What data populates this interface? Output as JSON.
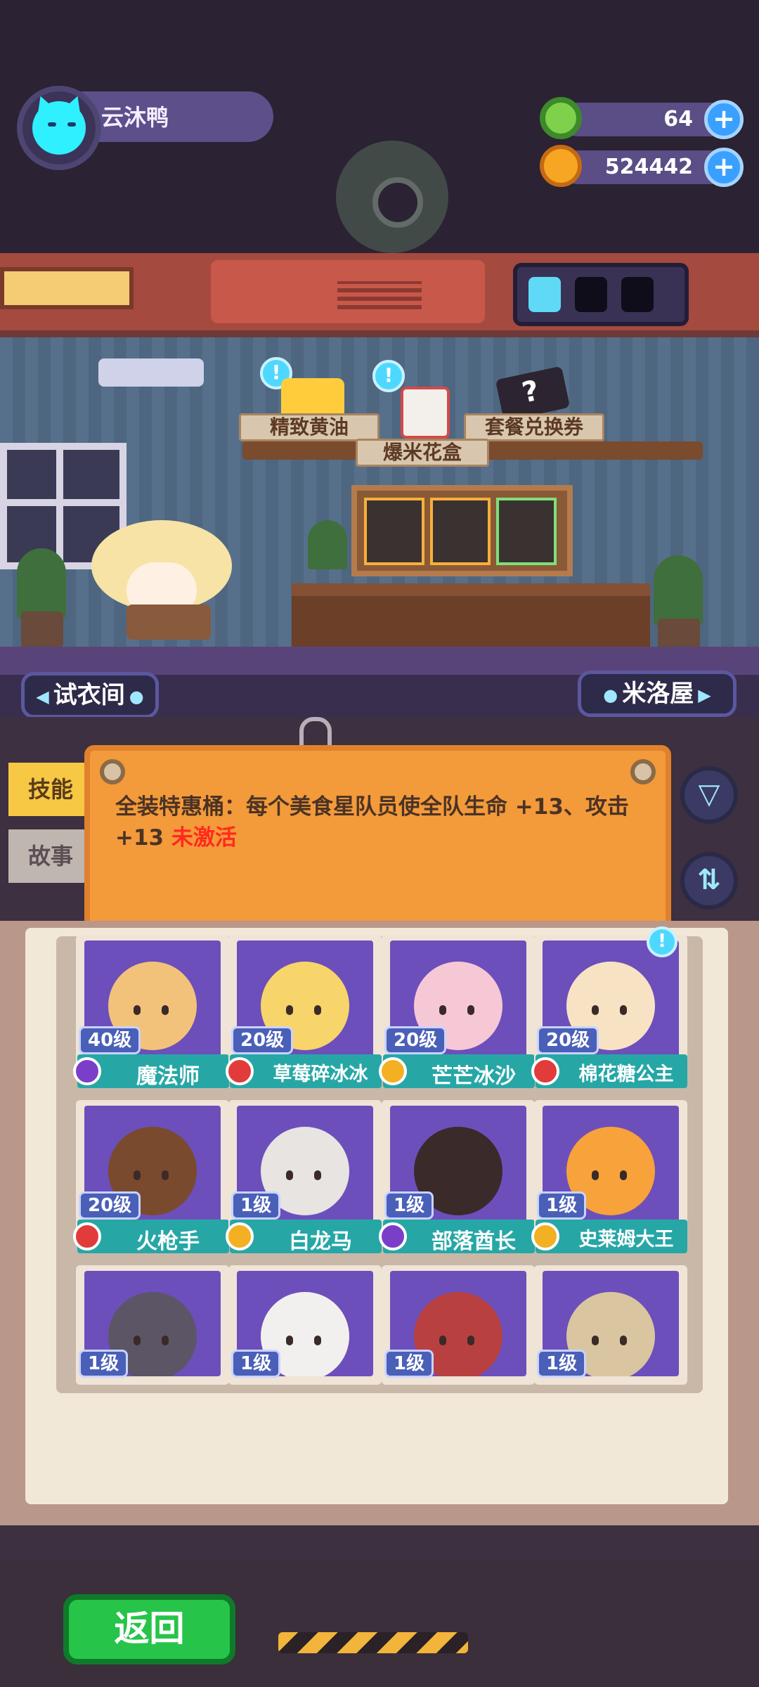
{
  "player": {
    "name": "云沐鸭"
  },
  "currencies": [
    {
      "name": "donut",
      "value": "64",
      "color": "#7fd04b"
    },
    {
      "name": "planet-coin",
      "value": "524442",
      "color": "#f6a623"
    }
  ],
  "shop_items": [
    {
      "label": "精致黄油"
    },
    {
      "label": "爆米花盒"
    },
    {
      "label": "套餐兑换券"
    }
  ],
  "scene_nav": {
    "left": "试衣间",
    "right": "米洛屋"
  },
  "side_tabs": [
    "技能",
    "故事"
  ],
  "skill": {
    "text": "全装特惠桶：每个美食星队员使全队生命 +13、攻击 +13",
    "status": "未激活"
  },
  "icons": {
    "filter": "filter-icon",
    "sort": "sort-icon",
    "plus": "plus-icon",
    "notice": "exclamation-icon"
  },
  "characters": [
    {
      "level": "40级",
      "name": "魔法师",
      "badge_color": "#7a3fc9",
      "head_color": "#f3c27a"
    },
    {
      "level": "20级",
      "name": "草莓碎冰冰",
      "badge_color": "#e23b3b",
      "head_color": "#f7d56a"
    },
    {
      "level": "20级",
      "name": "芒芒冰沙",
      "badge_color": "#f3b022",
      "head_color": "#f6c8d6"
    },
    {
      "level": "20级",
      "name": "棉花糖公主",
      "badge_color": "#e23b3b",
      "head_color": "#f7e3c4",
      "notice": "!"
    },
    {
      "level": "20级",
      "name": "火枪手",
      "badge_color": "#e23b3b",
      "head_color": "#7a4a2e"
    },
    {
      "level": "1级",
      "name": "白龙马",
      "badge_color": "#f3b022",
      "head_color": "#e8e4e2"
    },
    {
      "level": "1级",
      "name": "部落酋长",
      "badge_color": "#7a3fc9",
      "head_color": "#3a2a2a"
    },
    {
      "level": "1级",
      "name": "史莱姆大王",
      "badge_color": "#f3b022",
      "head_color": "#f7a23a"
    },
    {
      "level": "1级",
      "name": "",
      "badge_color": "",
      "head_color": "#5c5566"
    },
    {
      "level": "1级",
      "name": "",
      "badge_color": "",
      "head_color": "#f2f0ee"
    },
    {
      "level": "1级",
      "name": "",
      "badge_color": "",
      "head_color": "#b84040"
    },
    {
      "level": "1级",
      "name": "",
      "badge_color": "",
      "head_color": "#d9c6a0"
    }
  ],
  "back_button": "返回"
}
